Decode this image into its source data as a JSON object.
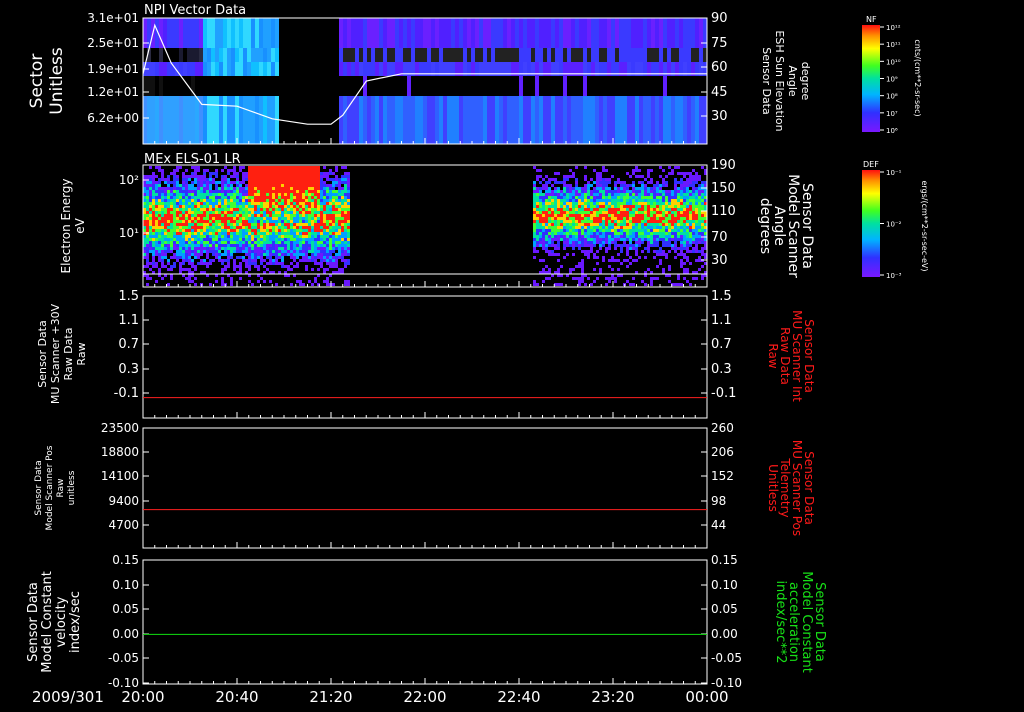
{
  "date_label": "2009/301",
  "time_ticks": [
    "20:00",
    "20:40",
    "21:20",
    "22:00",
    "22:40",
    "23:20",
    "00:00"
  ],
  "colors": {
    "red_trace": "#ff2020",
    "green_trace": "#10e010",
    "axis": "#ffffff",
    "red_label": "#ff1a1a",
    "green_label": "#18e018"
  },
  "panels": [
    {
      "id": "p1",
      "title": "NPI Vector Data",
      "left_label": [
        "Sector",
        "Unitless"
      ],
      "left_ticks": [
        "3.1e+01",
        "2.5e+01",
        "1.9e+01",
        "1.2e+01",
        "6.2e+00"
      ],
      "right_label": [
        "Sensor Data",
        "ESH Sun Elevation",
        "Angle",
        "degree"
      ],
      "right_ticks": [
        "90",
        "75",
        "60",
        "45",
        "30"
      ],
      "colorbar": {
        "name": "NF",
        "unit": "cnts/(cm**2-sr-sec)",
        "ticks": [
          "10¹²",
          "10¹¹",
          "10¹⁰",
          "10⁹",
          "10⁸",
          "10⁷",
          "10⁶"
        ]
      }
    },
    {
      "id": "p2",
      "title": "MEx ELS-01 LR",
      "left_label": [
        "Electron Energy",
        "eV"
      ],
      "left_ticks": [
        "10²",
        "10¹"
      ],
      "right_label": [
        "Sensor Data",
        "Model Scanner",
        "Angle",
        "degrees"
      ],
      "right_ticks": [
        "190",
        "150",
        "110",
        "70",
        "30"
      ],
      "colorbar": {
        "name": "DEF",
        "unit": "ergs/(cm**2-sr-sec-eV)",
        "ticks": [
          "10⁻¹",
          "10⁻²",
          "10⁻³"
        ]
      }
    },
    {
      "id": "p3",
      "left_label": [
        "Sensor Data",
        "MU Scanner +30V",
        "Raw Data",
        "Raw"
      ],
      "left_ticks": [
        "1.5",
        "1.1",
        "0.7",
        "0.3",
        "-0.1"
      ],
      "right_label": [
        "Sensor Data",
        "MU Scanner Int",
        "Raw Data",
        "Raw"
      ],
      "right_ticks": [
        "1.5",
        "1.1",
        "0.7",
        "0.3",
        "-0.1"
      ]
    },
    {
      "id": "p4",
      "left_label": [
        "Sensor Data",
        "Model Scanner Pos",
        "Raw",
        "unitless"
      ],
      "left_ticks": [
        "23500",
        "18800",
        "14100",
        "9400",
        "4700"
      ],
      "right_label": [
        "Sensor Data",
        "MU Scanner Pos",
        "Telemetry",
        "Unitless"
      ],
      "right_ticks": [
        "260",
        "206",
        "152",
        "98",
        "44"
      ]
    },
    {
      "id": "p5",
      "left_label": [
        "Sensor Data",
        "Model Constant",
        "velocity",
        "index/sec"
      ],
      "left_ticks": [
        "0.15",
        "0.10",
        "0.05",
        "0.00",
        "-0.05",
        "-0.10"
      ],
      "right_label": [
        "Sensor Data",
        "Model Constant",
        "acceleration",
        "index/sec**2"
      ],
      "right_ticks": [
        "0.15",
        "0.10",
        "0.05",
        "0.00",
        "-0.05",
        "-0.10"
      ]
    }
  ],
  "chart_data": [
    {
      "type": "heatmap",
      "title": "NPI Vector Data",
      "ylabel": "Sector Unitless",
      "ylim": [
        3.1,
        31
      ],
      "x_ticks": [
        "20:00",
        "20:40",
        "21:20",
        "22:00",
        "22:40",
        "23:20",
        "00:00"
      ],
      "data_gap": {
        "start": "20:57",
        "end": "21:22"
      },
      "overlay_series": {
        "name": "ESH Sun Elevation Angle",
        "unit": "degree",
        "ylim": [
          20,
          90
        ],
        "x": [
          "20:00",
          "20:05",
          "20:12",
          "20:25",
          "20:40",
          "20:55",
          "21:10",
          "21:20",
          "21:25",
          "21:35",
          "21:50",
          "22:30",
          "23:30",
          "00:00"
        ],
        "y": [
          59,
          86,
          65,
          42,
          41,
          34,
          31,
          31,
          36,
          55,
          59,
          59,
          59,
          59
        ]
      }
    },
    {
      "type": "heatmap",
      "title": "MEx ELS-01 LR",
      "ylabel": "Electron Energy (eV)",
      "yscale": "log",
      "x_ticks": [
        "20:00",
        "20:40",
        "21:20",
        "22:00",
        "22:40",
        "23:20",
        "00:00"
      ],
      "data_gap": {
        "start": "21:28",
        "end": "22:45"
      },
      "overlay_series": {
        "name": "Model Scanner Angle",
        "unit": "degrees",
        "ylim": [
          10,
          190
        ],
        "x": [
          "20:00",
          "00:00"
        ],
        "y": [
          10,
          10
        ]
      }
    },
    {
      "type": "line",
      "ylabel": "MU Scanner +30V Raw",
      "ylim": [
        -0.3,
        1.5
      ],
      "series": [
        {
          "name": "MU Scanner Int Raw Data",
          "x": [
            "20:00",
            "00:00"
          ],
          "y": [
            0.0,
            0.0
          ]
        }
      ]
    },
    {
      "type": "line",
      "ylabel": "Model Scanner Pos Raw unitless",
      "ylim": [
        0,
        23500
      ],
      "series": [
        {
          "name": "MU Scanner Pos Telemetry",
          "x": [
            "20:00",
            "00:00"
          ],
          "y": [
            8300,
            8300
          ]
        }
      ]
    },
    {
      "type": "line",
      "ylabel": "Model Constant velocity index/sec",
      "ylim": [
        -0.1,
        0.15
      ],
      "series": [
        {
          "name": "Model Constant acceleration",
          "x": [
            "20:00",
            "00:00"
          ],
          "y": [
            0.0,
            0.0
          ]
        }
      ]
    }
  ]
}
